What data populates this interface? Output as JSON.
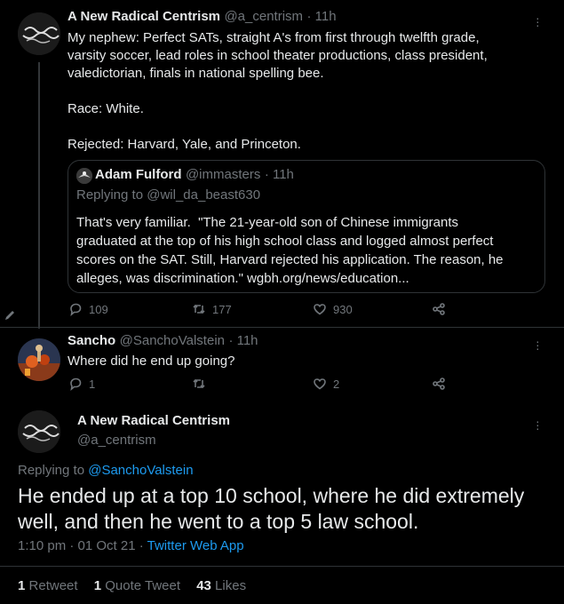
{
  "tweet1": {
    "name": "A New Radical Centrism",
    "handle": "@a_centrism",
    "time": "· 11h",
    "text": "My nephew: Perfect SATs, straight A's from first through twelfth grade,\nvarsity soccer, lead roles in school theater productions, class president,\nvaledictorian, finals in national spelling bee.\n\nRace: White.\n\nRejected: Harvard, Yale, and Princeton.",
    "quote": {
      "name": "Adam Fulford",
      "handle": "@immasters",
      "time": "· 11h",
      "replying_prefix": "Replying to",
      "replying_to": "@wil_da_beast630",
      "text": "That's very familiar.  \"The 21-year-old son of Chinese immigrants\ngraduated at the top of his high school class and logged almost perfect\nscores on the SAT. Still, Harvard rejected his application. The reason, he\nalleges, was discrimination.\" wgbh.org/news/education..."
    },
    "replies": "109",
    "retweets": "177",
    "likes": "930"
  },
  "tweet2": {
    "name": "Sancho",
    "handle": "@SanchoValstein",
    "time": "· 11h",
    "text": "Where did he end up going?",
    "replies": "1",
    "retweets": "",
    "likes": "2"
  },
  "main": {
    "name": "A New Radical Centrism",
    "handle": "@a_centrism",
    "replying_prefix": "Replying to",
    "replying_to": "@SanchoValstein",
    "text": "He ended up at a top 10 school, where he did extremely\nwell, and then he went to a top 5 law school.",
    "time": "1:10 pm · 01 Oct 21 ·",
    "source": "Twitter Web App",
    "stats": [
      {
        "count": "1",
        "label": "Retweet"
      },
      {
        "count": "1",
        "label": "Quote Tweet"
      },
      {
        "count": "43",
        "label": "Likes"
      }
    ]
  },
  "colors": {
    "background": "#000000",
    "text": "#e7e9ea",
    "muted": "#71767b",
    "accent": "#1d9bf0",
    "border": "#2f3336"
  }
}
